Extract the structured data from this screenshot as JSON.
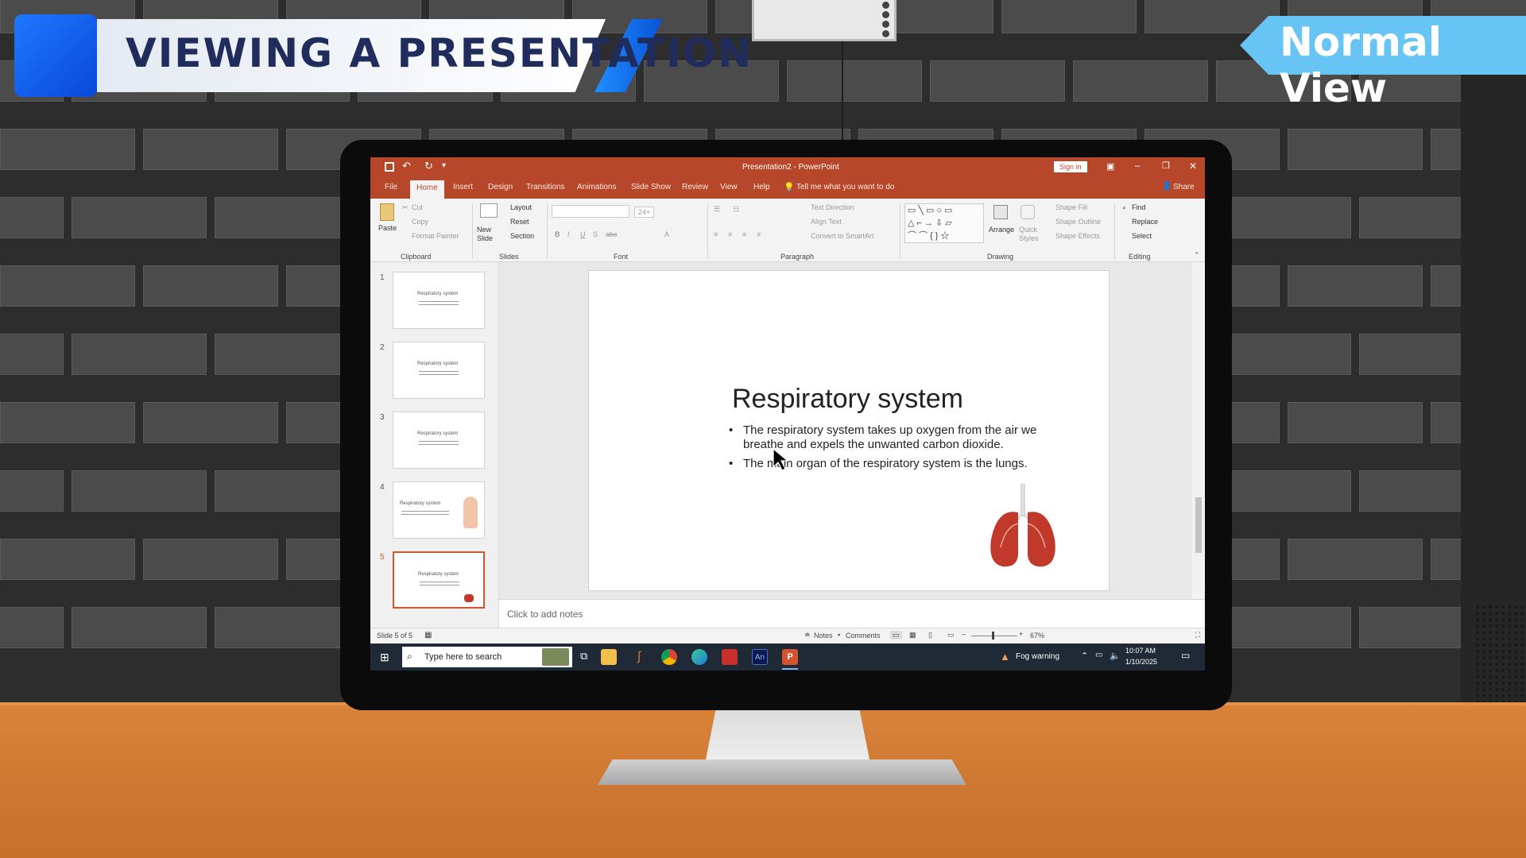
{
  "overlay": {
    "banner_title": "VIEWING A PRESENTATION",
    "view_label": "Normal View"
  },
  "colors": {
    "accent": "#b7472a",
    "banner_blue": "#1e78ff",
    "view_label_bg": "#67c4f5"
  },
  "app": {
    "title": "Presentation2 - PowerPoint",
    "sign_in": "Sign in",
    "share": "Share",
    "tell_me": "Tell me what you want to do"
  },
  "tabs": [
    "File",
    "Home",
    "Insert",
    "Design",
    "Transitions",
    "Animations",
    "Slide Show",
    "Review",
    "View",
    "Help"
  ],
  "ribbon": {
    "clipboard": {
      "label": "Clipboard",
      "paste": "Paste",
      "cut": "Cut",
      "copy": "Copy",
      "format_painter": "Format Painter"
    },
    "slides": {
      "label": "Slides",
      "new_slide": "New Slide",
      "layout": "Layout",
      "reset": "Reset",
      "section": "Section"
    },
    "font": {
      "label": "Font",
      "size": "24+"
    },
    "paragraph": {
      "label": "Paragraph",
      "text_direction": "Text Direction",
      "align_text": "Align Text",
      "convert_smartart": "Convert to SmartArt"
    },
    "drawing": {
      "label": "Drawing",
      "arrange": "Arrange",
      "quick_styles": "Quick Styles",
      "shape_fill": "Shape Fill",
      "shape_outline": "Shape Outline",
      "shape_effects": "Shape Effects"
    },
    "editing": {
      "label": "Editing",
      "find": "Find",
      "replace": "Replace",
      "select": "Select"
    }
  },
  "thumbnails": [
    {
      "num": "1",
      "title": "Respiratory system"
    },
    {
      "num": "2",
      "title": "Respiratory system"
    },
    {
      "num": "3",
      "title": "Respiratory system"
    },
    {
      "num": "4",
      "title": "Respiratory system"
    },
    {
      "num": "5",
      "title": "Respiratory system"
    }
  ],
  "slide": {
    "title": "Respiratory system",
    "bullets": [
      "The respiratory system takes up oxygen from the air we breathe and expels the unwanted carbon dioxide.",
      "The main organ of the respiratory system is the lungs."
    ]
  },
  "notes_placeholder": "Click to add notes",
  "status": {
    "slide_counter": "Slide 5 of 5",
    "notes": "Notes",
    "comments": "Comments",
    "zoom": "67%"
  },
  "taskbar": {
    "search_placeholder": "Type here to search",
    "weather": "Fog warning",
    "time": "10:07 AM",
    "date": "1/10/2025",
    "an_label": "An"
  }
}
